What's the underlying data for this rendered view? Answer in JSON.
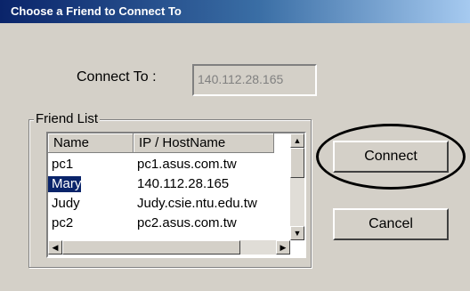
{
  "window": {
    "title": "Choose a Friend to Connect To"
  },
  "connect_to": {
    "label": "Connect To :",
    "value": "140.112.28.165"
  },
  "friend_list": {
    "group_label": "Friend List",
    "columns": [
      "Name",
      "IP / HostName"
    ],
    "rows": [
      {
        "name": "pc1",
        "host": "pc1.asus.com.tw"
      },
      {
        "name": "Mary",
        "host": "140.112.28.165",
        "selected": true
      },
      {
        "name": "Judy",
        "host": "Judy.csie.ntu.edu.tw"
      },
      {
        "name": "pc2",
        "host": "pc2.asus.com.tw"
      }
    ]
  },
  "buttons": {
    "connect": "Connect",
    "cancel": "Cancel"
  },
  "icons": {
    "scroll_up": "▲",
    "scroll_down": "▼",
    "scroll_left": "◀",
    "scroll_right": "▶"
  }
}
